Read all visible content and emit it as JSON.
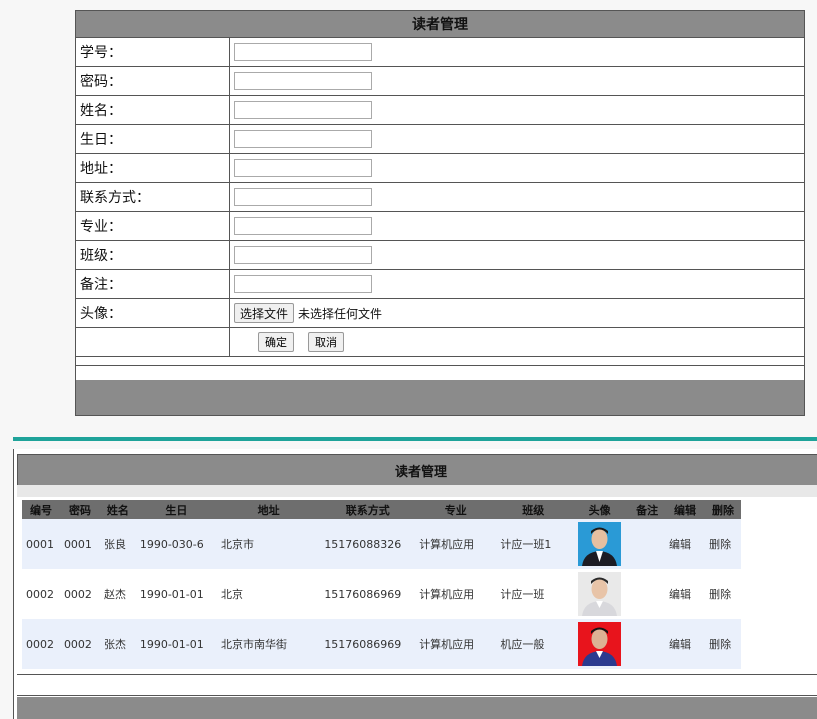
{
  "form": {
    "title": "读者管理",
    "fields": [
      {
        "label": "学号：",
        "value": ""
      },
      {
        "label": "密码：",
        "value": ""
      },
      {
        "label": "姓名：",
        "value": ""
      },
      {
        "label": "生日：",
        "value": ""
      },
      {
        "label": "地址：",
        "value": ""
      },
      {
        "label": "联系方式：",
        "value": ""
      },
      {
        "label": "专业：",
        "value": ""
      },
      {
        "label": "班级：",
        "value": ""
      },
      {
        "label": "备注：",
        "value": ""
      }
    ],
    "avatar": {
      "label": "头像：",
      "button": "选择文件",
      "status": "未选择任何文件"
    },
    "confirm": "确定",
    "cancel": "取消"
  },
  "list": {
    "title": "读者管理",
    "columns": [
      "编号",
      "密码",
      "姓名",
      "生日",
      "地址",
      "联系方式",
      "专业",
      "班级",
      "头像",
      "备注",
      "编辑",
      "删除"
    ],
    "rows": [
      {
        "id": "0001",
        "password": "0001",
        "name": "张良",
        "birthday": "1990-030-6",
        "address": "北京市",
        "phone": "15176088326",
        "major": "计算机应用",
        "class": "计应一班1",
        "note": "",
        "edit": "编辑",
        "delete": "删除",
        "avatar_bg": "#2a9ad6"
      },
      {
        "id": "0002",
        "password": "0002",
        "name": "赵杰",
        "birthday": "1990-01-01",
        "address": "北京",
        "phone": "15176086969",
        "major": "计算机应用",
        "class": "计应一班",
        "note": "",
        "edit": "编辑",
        "delete": "删除",
        "avatar_bg": "#e9e9e9"
      },
      {
        "id": "0002",
        "password": "0002",
        "name": "张杰",
        "birthday": "1990-01-01",
        "address": "北京市南华街",
        "phone": "15176086969",
        "major": "计算机应用",
        "class": "机应一般",
        "note": "",
        "edit": "编辑",
        "delete": "删除",
        "avatar_bg": "#e8141c"
      }
    ]
  }
}
